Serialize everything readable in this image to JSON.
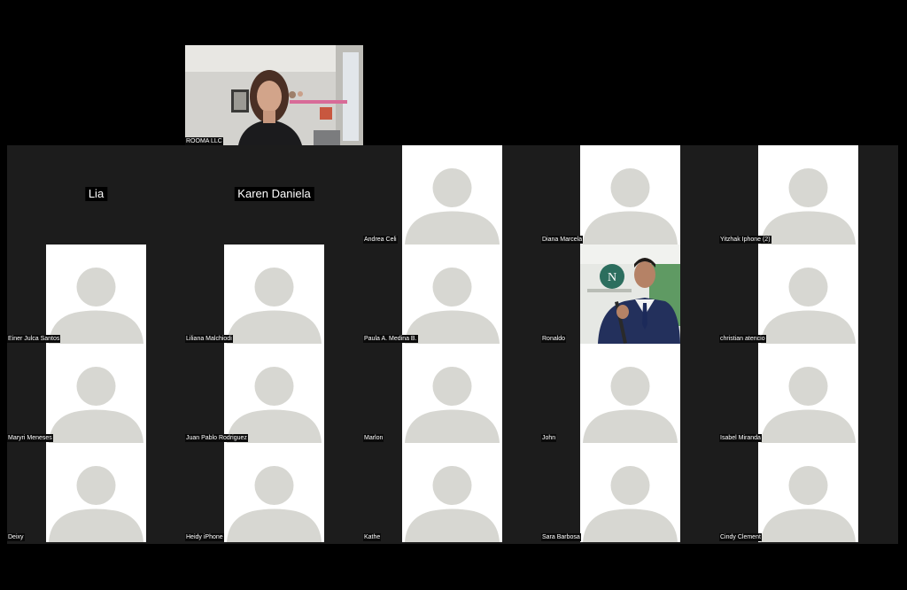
{
  "speaker": {
    "name": "ROOMA LLC"
  },
  "tiles": {
    "lia": {
      "name": "Lia"
    },
    "karen": {
      "name": "Karen Daniela"
    },
    "andrea": {
      "name": "Andrea Celi"
    },
    "diana": {
      "name": "Diana Marcela"
    },
    "yitzhak": {
      "name": "Yitzhak Iphone (2)"
    },
    "einer": {
      "name": "Einer Julca Santos"
    },
    "liliana": {
      "name": "Liliana Malchiodi"
    },
    "paula": {
      "name": "Paula A. Medina B."
    },
    "ronaldo": {
      "name": "Ronaldo"
    },
    "christian": {
      "name": "christian atencio"
    },
    "maryri": {
      "name": "Maryri Meneses"
    },
    "juanpablo": {
      "name": "Juan Pablo Rodriguez"
    },
    "marlon": {
      "name": "Marlon"
    },
    "john": {
      "name": "John"
    },
    "isabel": {
      "name": "Isabel Miranda"
    },
    "deixy": {
      "name": "Deixy"
    },
    "heidy": {
      "name": "Heidy iPhone"
    },
    "kathe": {
      "name": "Kathe"
    },
    "sara": {
      "name": "Sara Barbosa"
    },
    "cindy": {
      "name": "Cindy Clement"
    }
  },
  "colors": {
    "tile_bg": "#1c1c1c",
    "avatar_bg": "#ffffff",
    "avatar_fg": "#d7d7d2",
    "page_bg": "#000000"
  }
}
